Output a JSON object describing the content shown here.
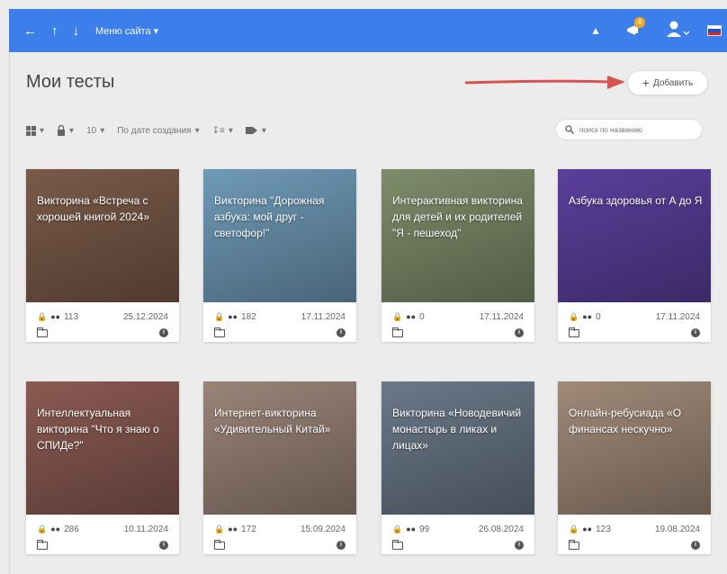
{
  "topbar": {
    "back_icon": "arrow-left-icon",
    "up_icon": "arrow-up-icon",
    "down_icon": "arrow-down-icon",
    "menu_label": "Меню сайта",
    "notification_count": "4",
    "bg_color": "#3d7fea"
  },
  "page": {
    "title": "Мои тесты",
    "add_label": "Добавить"
  },
  "toolbar": {
    "per_page": "10",
    "sort_label": "По дате создания",
    "search_placeholder": "поиск по названию"
  },
  "cards": [
    {
      "title": "Викторина «Встреча с хорошей книгой 2024»",
      "count": "113",
      "date": "25.12.2024",
      "locked": false,
      "bg": "#7a5a48"
    },
    {
      "title": "Викторина \"Дорожная азбука: мой друг - светофор!\"",
      "count": "182",
      "date": "17.11.2024",
      "locked": false,
      "bg": "#6f9ab8"
    },
    {
      "title": "Интерактивная викторина для детей и их родителей \"Я - пешеход\"",
      "count": "0",
      "date": "17.11.2024",
      "locked": true,
      "bg": "#7f8c6a"
    },
    {
      "title": "Азбука здоровья от А до Я",
      "count": "0",
      "date": "17.11.2024",
      "locked": true,
      "bg": "#5b3f9c"
    },
    {
      "title": "Интеллектуальная викторина \"Что я знаю о СПИДе?\"",
      "count": "286",
      "date": "10.11.2024",
      "locked": false,
      "bg": "#8a5a52"
    },
    {
      "title": "Интернет-викторина «Удивительный Китай»",
      "count": "172",
      "date": "15.09.2024",
      "locked": false,
      "bg": "#9a8478"
    },
    {
      "title": "Викторина «Новодевичий монастырь в ликах и лицах»",
      "count": "99",
      "date": "26.08.2024",
      "locked": false,
      "bg": "#6a7888"
    },
    {
      "title": "Онлайн-ребусиада «О финансах нескучно»",
      "count": "123",
      "date": "19.08.2024",
      "locked": false,
      "bg": "#a08a78"
    }
  ]
}
